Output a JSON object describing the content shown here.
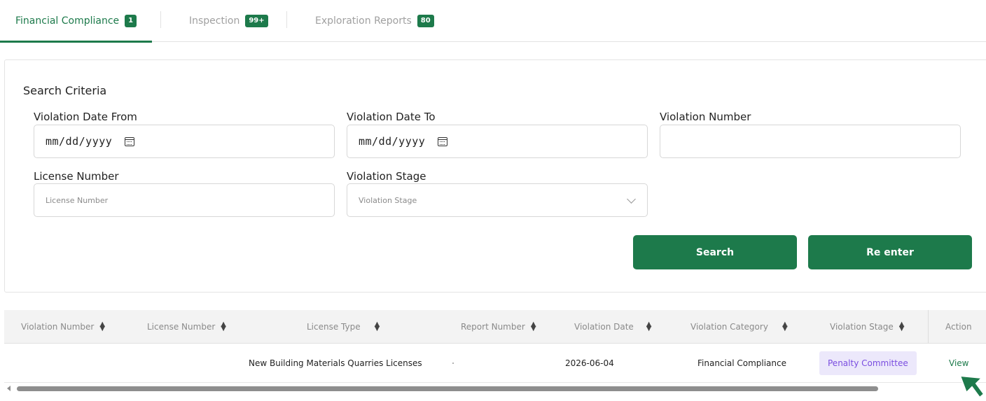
{
  "tabs": [
    {
      "label": "Financial Compliance",
      "badge": "1"
    },
    {
      "label": "Inspection",
      "badge": "99+"
    },
    {
      "label": "Exploration Reports",
      "badge": "80"
    }
  ],
  "search": {
    "title": "Search Criteria",
    "date_from_label": "Violation Date From",
    "date_from_value": "mm/dd/yyyy",
    "date_to_label": "Violation Date To",
    "date_to_value": "mm/dd/yyyy",
    "violation_number_label": "Violation Number",
    "license_number_label": "License Number",
    "license_number_placeholder": "License Number",
    "stage_label": "Violation Stage",
    "stage_placeholder": "Violation Stage",
    "search_button": "Search",
    "reenter_button": "Re enter"
  },
  "table": {
    "headers": {
      "violation_number": "Violation Number",
      "license_number": "License Number",
      "license_type": "License Type",
      "report_number": "Report Number",
      "violation_date": "Violation Date",
      "violation_category": "Violation Category",
      "violation_stage": "Violation Stage",
      "action": "Action"
    },
    "rows": [
      {
        "violation_number": "",
        "license_number": "",
        "license_type": "New Building Materials Quarries Licenses",
        "report_number": "",
        "violation_date": "2026-06-04",
        "violation_category": "Financial Compliance",
        "violation_stage": "Penalty Committee",
        "action": "View"
      }
    ]
  },
  "colors": {
    "accent": "#1d7a4b",
    "stage_tag_bg": "#ece8fb",
    "stage_tag_text": "#7a4de0"
  }
}
